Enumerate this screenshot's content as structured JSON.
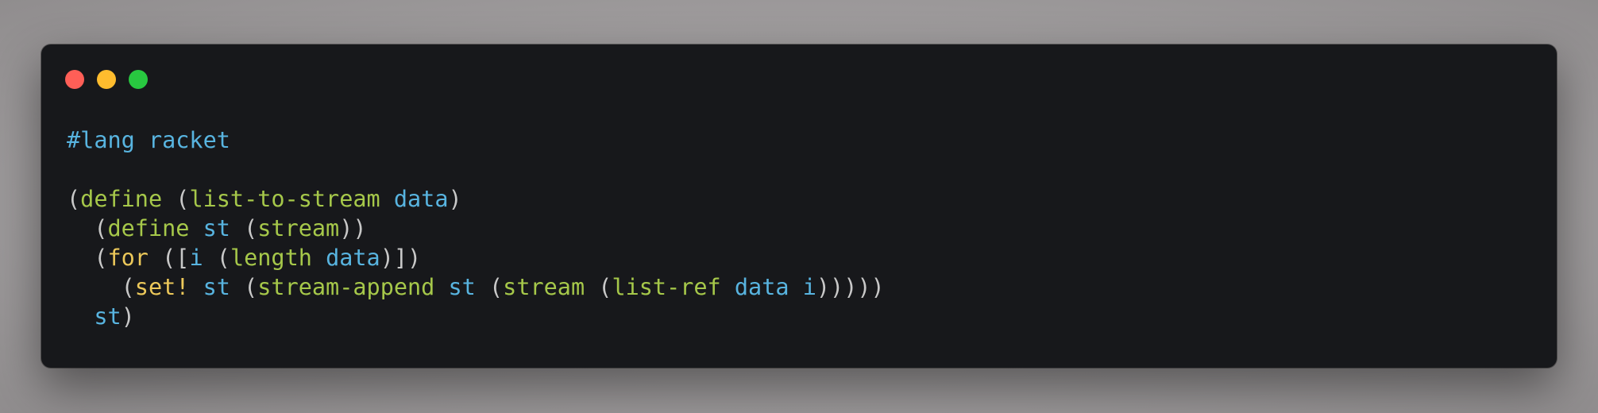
{
  "window": {
    "buttons": [
      {
        "name": "close",
        "color": "#ff5f57"
      },
      {
        "name": "minimize",
        "color": "#febc2e"
      },
      {
        "name": "maximize",
        "color": "#28c840"
      }
    ]
  },
  "colors": {
    "punct": "#c8c8c8",
    "keyword": "#a6c84a",
    "identifier": "#58b4e0",
    "special": "#ecc85a"
  },
  "code": {
    "lines": [
      [
        {
          "t": "#lang racket",
          "c": "identifier"
        }
      ],
      [],
      [
        {
          "t": "(",
          "c": "punct"
        },
        {
          "t": "define",
          "c": "keyword"
        },
        {
          "t": " (",
          "c": "punct"
        },
        {
          "t": "list-to-stream",
          "c": "keyword"
        },
        {
          "t": " ",
          "c": "punct"
        },
        {
          "t": "data",
          "c": "identifier"
        },
        {
          "t": ")",
          "c": "punct"
        }
      ],
      [
        {
          "t": "  (",
          "c": "punct"
        },
        {
          "t": "define",
          "c": "keyword"
        },
        {
          "t": " ",
          "c": "punct"
        },
        {
          "t": "st",
          "c": "identifier"
        },
        {
          "t": " (",
          "c": "punct"
        },
        {
          "t": "stream",
          "c": "keyword"
        },
        {
          "t": "))",
          "c": "punct"
        }
      ],
      [
        {
          "t": "  (",
          "c": "punct"
        },
        {
          "t": "for",
          "c": "special"
        },
        {
          "t": " ([",
          "c": "punct"
        },
        {
          "t": "i",
          "c": "identifier"
        },
        {
          "t": " (",
          "c": "punct"
        },
        {
          "t": "length",
          "c": "keyword"
        },
        {
          "t": " ",
          "c": "punct"
        },
        {
          "t": "data",
          "c": "identifier"
        },
        {
          "t": ")])",
          "c": "punct"
        }
      ],
      [
        {
          "t": "    (",
          "c": "punct"
        },
        {
          "t": "set!",
          "c": "special"
        },
        {
          "t": " ",
          "c": "punct"
        },
        {
          "t": "st",
          "c": "identifier"
        },
        {
          "t": " (",
          "c": "punct"
        },
        {
          "t": "stream-append",
          "c": "keyword"
        },
        {
          "t": " ",
          "c": "punct"
        },
        {
          "t": "st",
          "c": "identifier"
        },
        {
          "t": " (",
          "c": "punct"
        },
        {
          "t": "stream",
          "c": "keyword"
        },
        {
          "t": " (",
          "c": "punct"
        },
        {
          "t": "list-ref",
          "c": "keyword"
        },
        {
          "t": " ",
          "c": "punct"
        },
        {
          "t": "data",
          "c": "identifier"
        },
        {
          "t": " ",
          "c": "punct"
        },
        {
          "t": "i",
          "c": "identifier"
        },
        {
          "t": ")))))",
          "c": "punct"
        }
      ],
      [
        {
          "t": "  ",
          "c": "punct"
        },
        {
          "t": "st",
          "c": "identifier"
        },
        {
          "t": ")",
          "c": "punct"
        }
      ]
    ]
  }
}
